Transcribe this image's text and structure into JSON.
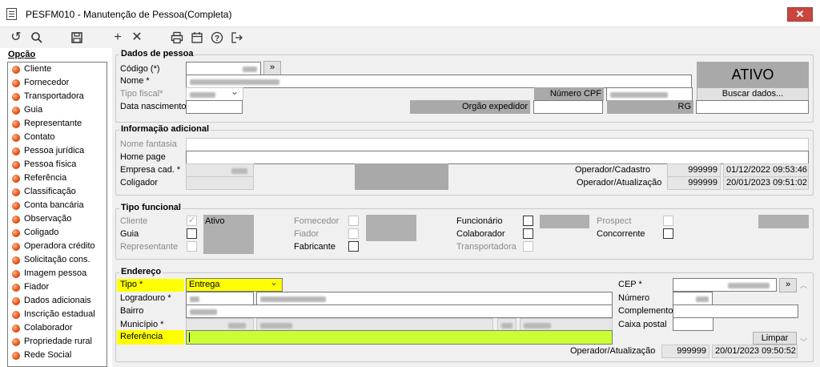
{
  "window": {
    "title": "PESFM010 - Manutenção de Pessoa(Completa)",
    "close_label": "✕"
  },
  "toolbar": {
    "buttons": [
      "undo-icon",
      "search-icon",
      "save-icon",
      "add-icon",
      "delete-icon",
      "print-icon",
      "calendar-icon",
      "help-icon",
      "exit-icon"
    ]
  },
  "sidebar": {
    "header": "Opção",
    "items": [
      "Cliente",
      "Fornecedor",
      "Transportadora",
      "Guia",
      "Representante",
      "Contato",
      "Pessoa jurídica",
      "Pessoa física",
      "Referência",
      "Classificação",
      "Conta bancária",
      "Observação",
      "Coligado",
      "Operadora crédito",
      "Solicitação cons.",
      "Imagem pessoa",
      "Fiador",
      "Dados adicionais",
      "Inscrição estadual",
      "Colaborador",
      "Propriedade rural",
      "Rede Social"
    ]
  },
  "dados": {
    "legend": "Dados de pessoa",
    "codigo_label": "Código (*)",
    "codigo_btn": "»",
    "nome_label": "Nome *",
    "tipo_fiscal_label": "Tipo fiscal*",
    "numero_cpf_label": "Número CPF",
    "data_nasc_label": "Data nascimento",
    "orgao_label": "Orgão expedidor",
    "rg_label": "RG",
    "status": "ATIVO",
    "buscar_label": "Buscar dados..."
  },
  "info": {
    "legend": "Informação adicional",
    "nome_fantasia_label": "Nome fantasia",
    "home_page_label": "Home page",
    "empresa_label": "Empresa cad. *",
    "coligador_label": "Coligador",
    "op_cadastro_label": "Operador/Cadastro",
    "op_cadastro_code": "999999",
    "op_cadastro_date": "01/12/2022 09:53:46",
    "op_atual_label": "Operador/Atualização",
    "op_atual_code": "999999",
    "op_atual_date": "20/01/2023 09:51:02"
  },
  "tipo": {
    "legend": "Tipo funcional",
    "cliente": "Cliente",
    "ativo": "Ativo",
    "guia": "Guia",
    "representante": "Representante",
    "fornecedor": "Fornecedor",
    "fiador": "Fiador",
    "fabricante": "Fabricante",
    "funcionario": "Funcionário",
    "colaborador": "Colaborador",
    "transportadora": "Transportadora",
    "prospect": "Prospect",
    "concorrente": "Concorrente"
  },
  "endereco": {
    "legend": "Endereço",
    "tipo_label": "Tipo *",
    "tipo_value": "Entrega",
    "logradouro_label": "Logradouro *",
    "bairro_label": "Bairro",
    "municipio_label": "Município *",
    "referencia_label": "Referência",
    "cep_label": "CEP *",
    "cep_btn": "»",
    "numero_label": "Número",
    "complemento_label": "Complemento",
    "caixa_label": "Caixa postal",
    "limpar_label": "Limpar",
    "op_atual_label": "Operador/Atualização",
    "op_atual_code": "999999",
    "op_atual_date": "20/01/2023 09:50:52"
  }
}
